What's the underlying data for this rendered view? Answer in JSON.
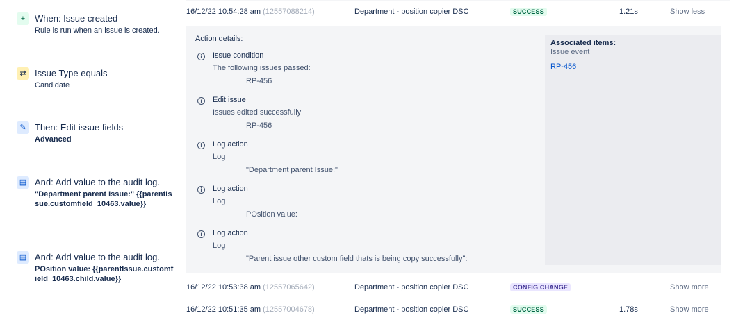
{
  "rule": {
    "steps": [
      {
        "type": "trigger",
        "icon": "plus-icon",
        "title": "When: Issue created",
        "sub": "Rule is run when an issue is created."
      },
      {
        "type": "condition",
        "icon": "shuffle-icon",
        "title": "Issue Type equals",
        "sub": "Candidate"
      },
      {
        "type": "action",
        "icon": "pencil-icon",
        "title": "Then: Edit issue fields",
        "bold": "Advanced"
      },
      {
        "type": "action",
        "icon": "audit-log-icon",
        "title": "And: Add value to the audit log.",
        "bold": "\"Department parent Issue:\" {{parentIssue.customfield_10463.value}}"
      },
      {
        "type": "action",
        "icon": "audit-log-icon",
        "title": "And: Add value to the audit log.",
        "bold": "POsition value: {{parentIssue.customfield_10463.child.value}}"
      }
    ]
  },
  "logs": [
    {
      "date": "16/12/22 10:54:28 am",
      "id": "(12557088214)",
      "rule": "Department - position copier DSC",
      "status": "SUCCESS",
      "duration": "1.21s",
      "toggle": "Show less"
    },
    {
      "date": "16/12/22 10:53:38 am",
      "id": "(12557065642)",
      "rule": "Department - position copier DSC",
      "status": "CONFIG CHANGE",
      "duration": "",
      "toggle": "Show more"
    },
    {
      "date": "16/12/22 10:51:35 am",
      "id": "(12557004678)",
      "rule": "Department - position copier DSC",
      "status": "SUCCESS",
      "duration": "1.78s",
      "toggle": "Show more"
    }
  ],
  "details": {
    "title": "Action details:",
    "entries": [
      {
        "title": "Issue condition",
        "desc": "The following issues passed:",
        "value": "RP-456"
      },
      {
        "title": "Edit issue",
        "desc": "Issues edited successfully",
        "value": "RP-456"
      },
      {
        "title": "Log action",
        "desc": "Log",
        "value": "\"Department parent Issue:\""
      },
      {
        "title": "Log action",
        "desc": "Log",
        "value": "POsition value:"
      },
      {
        "title": "Log action",
        "desc": "Log",
        "value": "\"Parent issue other custom field thats is being copy successfully\":"
      }
    ],
    "associated": {
      "title": "Associated items:",
      "sub": "Issue event",
      "link": "RP-456"
    }
  },
  "colors": {
    "success_bg": "#e3fcef",
    "success_fg": "#006644",
    "config_bg": "#eae6ff",
    "config_fg": "#403294",
    "link": "#0052cc"
  }
}
